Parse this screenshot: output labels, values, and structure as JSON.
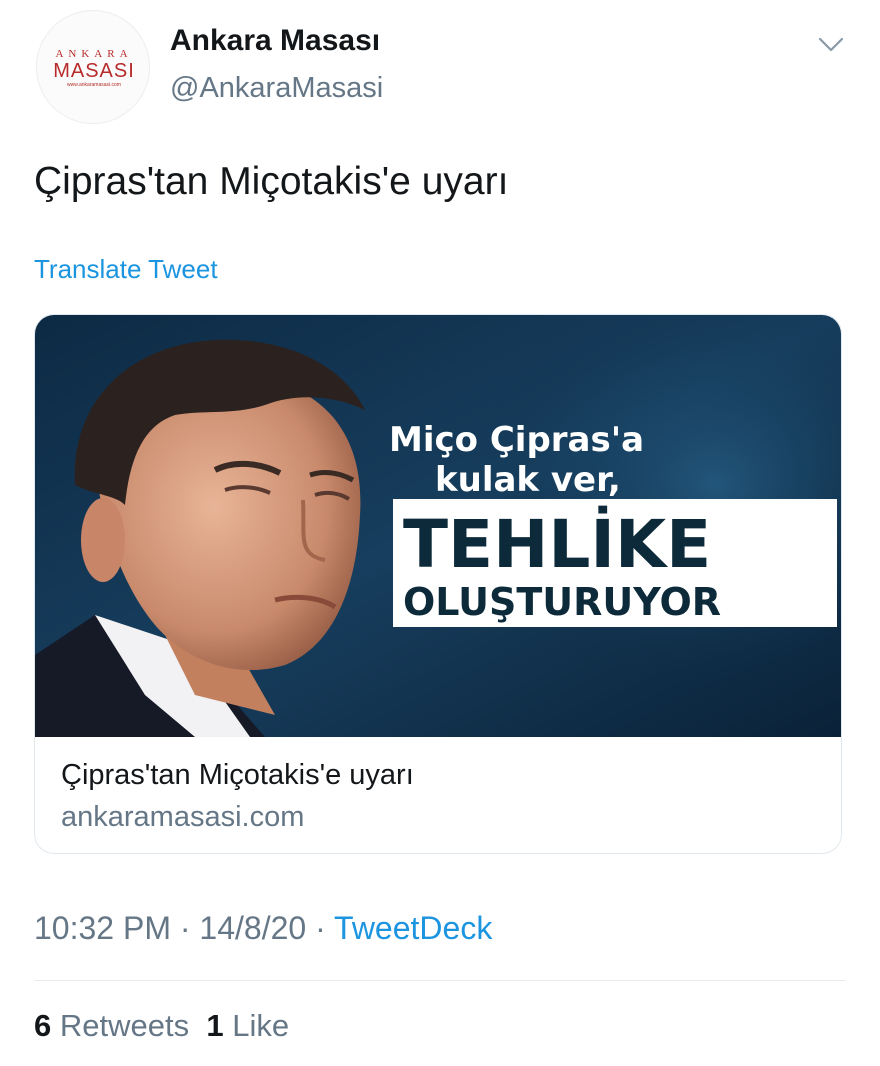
{
  "user": {
    "display_name": "Ankara Masası",
    "handle": "@AnkaraMasasi",
    "avatar_logo_text": "ANKARA MASASI"
  },
  "tweet": {
    "text": "Çipras'tan Miçotakis'e uyarı",
    "translate_label": "Translate Tweet"
  },
  "card": {
    "image_headline_1": "Miço Çipras'a",
    "image_headline_2": "kulak ver,",
    "image_headline_3": "TEHLİKE",
    "image_headline_4": "OLUŞTURUYOR",
    "title": "Çipras'tan Miçotakis'e uyarı",
    "domain": "ankaramasasi.com"
  },
  "meta": {
    "time": "10:32 PM",
    "date": "14/8/20",
    "separator": "·",
    "source": "TweetDeck"
  },
  "stats": {
    "retweets_count": "6",
    "retweets_label": "Retweets",
    "likes_count": "1",
    "likes_label": "Like"
  },
  "colors": {
    "link": "#1b95e0",
    "secondary_text": "#657786",
    "primary_text": "#14171a",
    "logo_red": "#b72b2b"
  },
  "icons": {
    "menu": "chevron-down-icon"
  }
}
